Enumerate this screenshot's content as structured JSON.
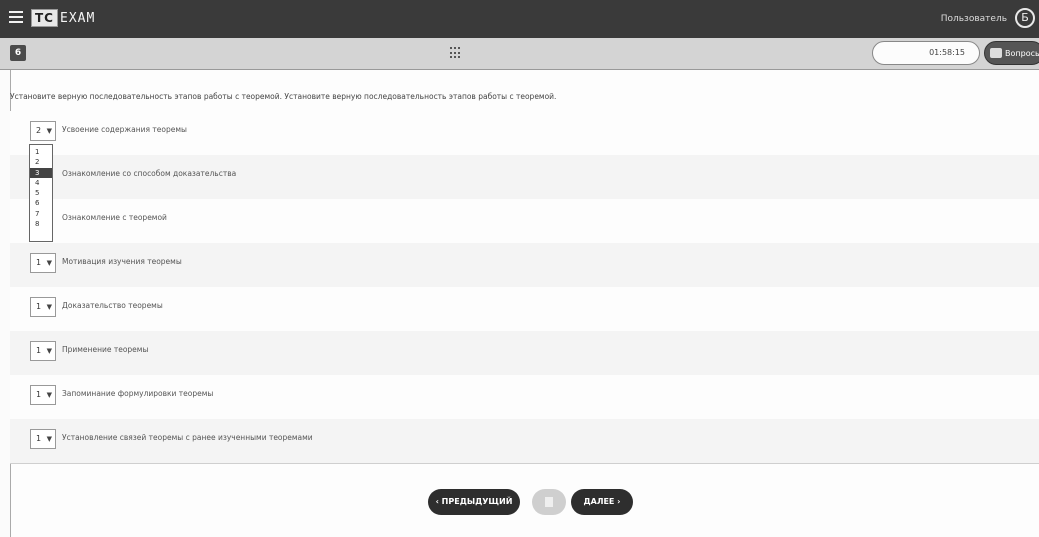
{
  "header": {
    "logo_tc": "TC",
    "logo_exam": "EXAM",
    "user_label": "Пользователь",
    "user_initial": "Б"
  },
  "subheader": {
    "question_number": "6",
    "timer": "01:58:15",
    "questions_label": "Вопросы"
  },
  "question": {
    "instruction": "Установите верную последовательность этапов работы с теоремой. Установите верную последовательность этапов работы с теоремой.",
    "items": [
      {
        "value": "2",
        "text": "Усвоение содержания теоремы"
      },
      {
        "value": "",
        "text": "Ознакомление со способом доказательства"
      },
      {
        "value": "",
        "text": "Ознакомление с теоремой"
      },
      {
        "value": "1",
        "text": "Мотивация изучения теоремы"
      },
      {
        "value": "1",
        "text": "Доказательство теоремы"
      },
      {
        "value": "1",
        "text": "Применение теоремы"
      },
      {
        "value": "1",
        "text": "Запоминание формулировки теоремы"
      },
      {
        "value": "1",
        "text": "Установление связей теоремы с ранее изученными теоремами"
      }
    ],
    "dropdown_options": [
      "1",
      "2",
      "3",
      "4",
      "5",
      "6",
      "7",
      "8"
    ],
    "dropdown_highlighted": "3"
  },
  "footer": {
    "prev_label": "‹ ПРЕДЫДУЩИЙ",
    "next_label": "ДАЛЕЕ ›"
  }
}
